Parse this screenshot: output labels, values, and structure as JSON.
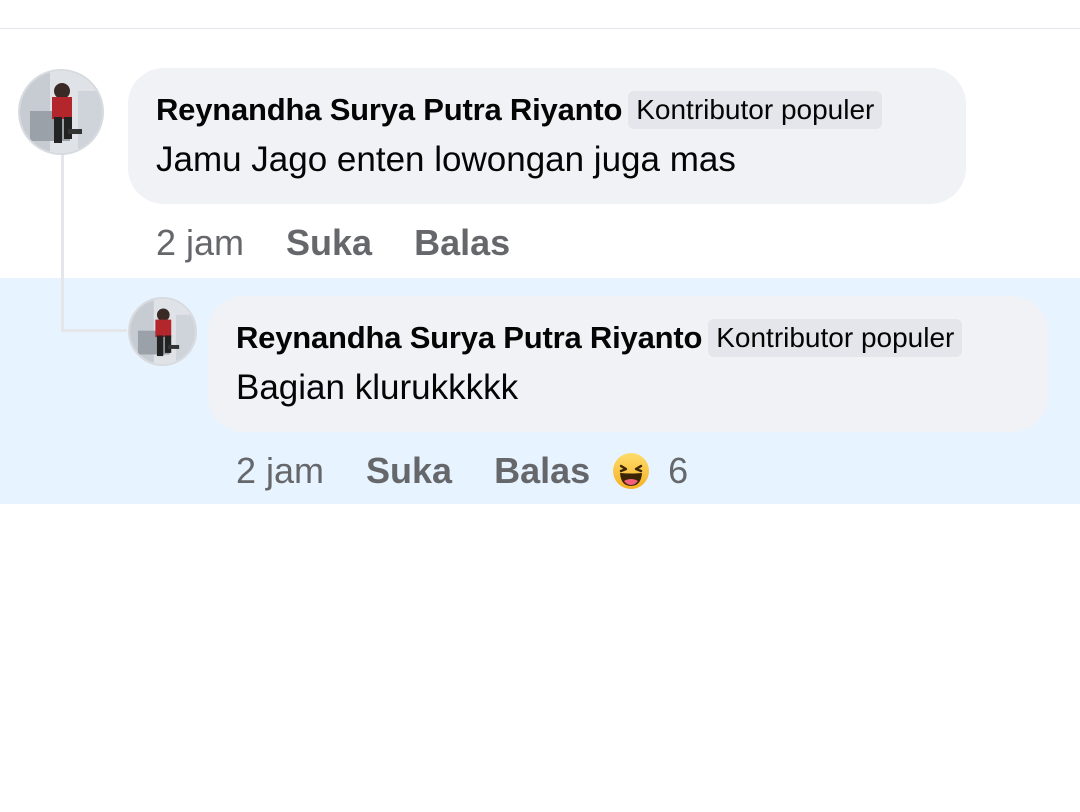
{
  "comments": [
    {
      "author": "Reynandha Surya Putra Riyanto",
      "badge": "Kontributor populer",
      "text": "Jamu Jago enten lowongan juga mas",
      "time": "2 jam",
      "like_label": "Suka",
      "reply_label": "Balas"
    }
  ],
  "reply": {
    "author": "Reynandha Surya Putra Riyanto",
    "badge": "Kontributor populer",
    "text": "Bagian klurukkkkk",
    "time": "2 jam",
    "like_label": "Suka",
    "reply_label": "Balas",
    "reaction_icon": "haha-emoji-icon",
    "reaction_count": "6"
  },
  "colors": {
    "bubble": "#f0f2f5",
    "highlight": "#e7f3ff",
    "secondary_text": "#65676b",
    "badge": "#e4e6eb"
  }
}
